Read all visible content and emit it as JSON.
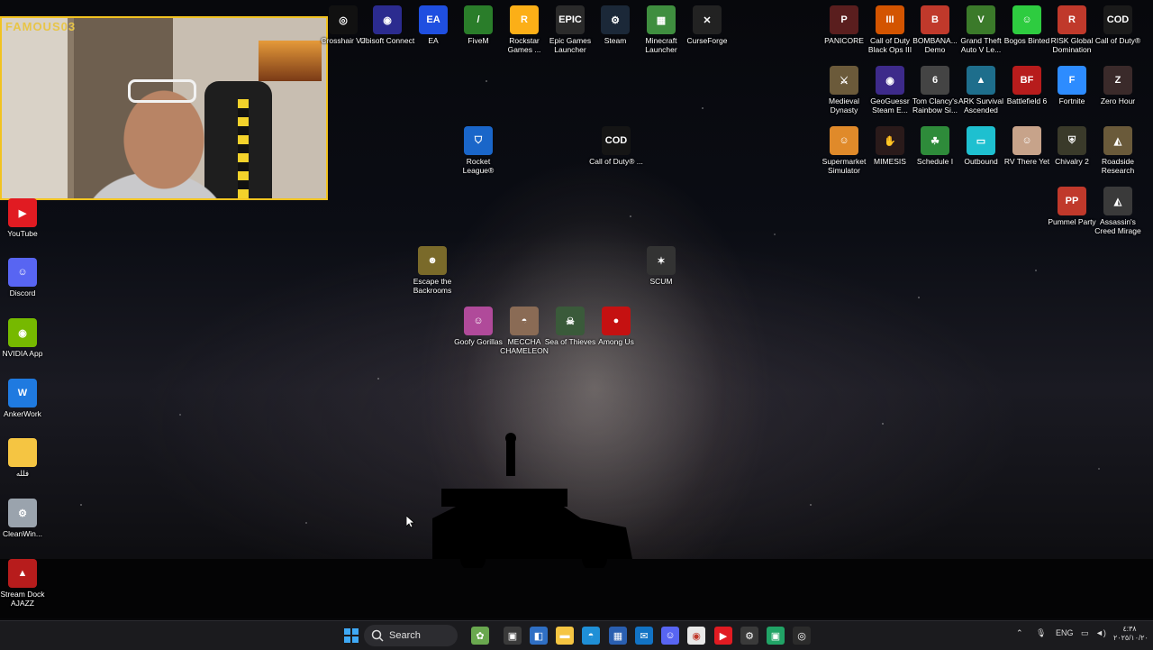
{
  "webcam": {
    "brand": "FAMOUS03"
  },
  "desktop_left": [
    {
      "label": "YouTube",
      "color": "#e11b22",
      "icon": "youtube-icon",
      "glyph": "▶"
    },
    {
      "label": "Discord",
      "color": "#5865f2",
      "icon": "discord-icon",
      "glyph": "☺"
    },
    {
      "label": "NVIDIA App",
      "color": "#76b900",
      "icon": "nvidia-icon",
      "glyph": "◉"
    },
    {
      "label": "AnkerWork",
      "color": "#1f7ae0",
      "icon": "ankerwork-icon",
      "glyph": "W"
    },
    {
      "label": "فلله",
      "color": "#f5c542",
      "icon": "folder-icon",
      "glyph": ""
    },
    {
      "label": "CleanWin...",
      "color": "#9aa3ad",
      "icon": "cleanwin-icon",
      "glyph": "⚙"
    },
    {
      "label": "Stream Dock AJAZZ",
      "color": "#b71c1c",
      "icon": "streamdock-icon",
      "glyph": "▲"
    }
  ],
  "desktop_top": [
    {
      "label": "Crosshair V2",
      "color": "#111111",
      "icon": "crosshair-icon",
      "glyph": "◎"
    },
    {
      "label": "Ubisoft Connect",
      "color": "#2b2b8f",
      "icon": "ubisoft-icon",
      "glyph": "◉"
    },
    {
      "label": "EA",
      "color": "#1f4fe0",
      "icon": "ea-icon",
      "glyph": "EA"
    },
    {
      "label": "FiveM",
      "color": "#2a7d2a",
      "icon": "fivem-icon",
      "glyph": "/"
    },
    {
      "label": "Rockstar Games ...",
      "color": "#fcaf17",
      "icon": "rockstar-icon",
      "glyph": "R"
    },
    {
      "label": "Epic Games Launcher",
      "color": "#2a2a2a",
      "icon": "epic-icon",
      "glyph": "EPIC"
    },
    {
      "label": "Steam",
      "color": "#1b2838",
      "icon": "steam-icon",
      "glyph": "⚙"
    },
    {
      "label": "Minecraft Launcher",
      "color": "#3f8e3f",
      "icon": "minecraft-icon",
      "glyph": "▦"
    },
    {
      "label": "CurseForge",
      "color": "#222222",
      "icon": "curseforge-icon",
      "glyph": "✕"
    }
  ],
  "desktop_mid": [
    {
      "label": "Rocket League®",
      "color": "#1a66c9",
      "icon": "rocket-league-icon",
      "glyph": "⛉"
    },
    {
      "label": "Call of Duty® ...",
      "color": "#151515",
      "icon": "cod-icon",
      "glyph": "COD"
    },
    {
      "label": "Escape the Backrooms",
      "color": "#7a6a2a",
      "icon": "backrooms-icon",
      "glyph": "☻"
    },
    {
      "label": "SCUM",
      "color": "#333333",
      "icon": "scum-icon",
      "glyph": "✶"
    },
    {
      "label": "Goofy Gorillas",
      "color": "#b04a9a",
      "icon": "goofy-gorillas-icon",
      "glyph": "☺"
    },
    {
      "label": "MECCHA CHAMELEON",
      "color": "#8a6b55",
      "icon": "meccha-icon",
      "glyph": "◓"
    },
    {
      "label": "Sea of Thieves",
      "color": "#3a5a3a",
      "icon": "sea-of-thieves-icon",
      "glyph": "☠"
    },
    {
      "label": "Among Us",
      "color": "#c51111",
      "icon": "among-us-icon",
      "glyph": "●"
    }
  ],
  "desktop_right": [
    {
      "label": "PANICORE",
      "color": "#5a1e1e",
      "icon": "panicore-icon",
      "glyph": "P"
    },
    {
      "label": "Call of Duty Black Ops III",
      "color": "#d35400",
      "icon": "bo3-icon",
      "glyph": "III"
    },
    {
      "label": "BOMBANA... Demo",
      "color": "#c0392b",
      "icon": "bombana-icon",
      "glyph": "B"
    },
    {
      "label": "Grand Theft Auto V Le...",
      "color": "#3b7a2a",
      "icon": "gta-icon",
      "glyph": "V"
    },
    {
      "label": "Bogos Binted",
      "color": "#2ecc40",
      "icon": "bogos-icon",
      "glyph": "☺"
    },
    {
      "label": "RISK Global Domination",
      "color": "#c0392b",
      "icon": "risk-icon",
      "glyph": "R"
    },
    {
      "label": "Call of Duty®",
      "color": "#1a1a1a",
      "icon": "cod-hq-icon",
      "glyph": "COD"
    },
    {
      "label": "Medieval Dynasty",
      "color": "#6b5a3a",
      "icon": "medieval-icon",
      "glyph": "⚔"
    },
    {
      "label": "GeoGuessr Steam E...",
      "color": "#3d2a8a",
      "icon": "geoguessr-icon",
      "glyph": "◉"
    },
    {
      "label": "Tom Clancy's Rainbow Si...",
      "color": "#444444",
      "icon": "rainbow-icon",
      "glyph": "6"
    },
    {
      "label": "ARK Survival Ascended",
      "color": "#1e6e8c",
      "icon": "ark-icon",
      "glyph": "▲"
    },
    {
      "label": "Battlefield 6",
      "color": "#b71c1c",
      "icon": "bf6-icon",
      "glyph": "BF"
    },
    {
      "label": "Fortnite",
      "color": "#2d8cff",
      "icon": "fortnite-icon",
      "glyph": "F"
    },
    {
      "label": "Zero Hour",
      "color": "#3a2a2a",
      "icon": "zero-hour-icon",
      "glyph": "Z"
    },
    {
      "label": "Supermarket Simulator",
      "color": "#e08a2a",
      "icon": "supermarket-icon",
      "glyph": "☺"
    },
    {
      "label": "MIMESIS",
      "color": "#2a1a1a",
      "icon": "mimesis-icon",
      "glyph": "✋"
    },
    {
      "label": "Schedule I",
      "color": "#2e8b3a",
      "icon": "schedule-icon",
      "glyph": "☘"
    },
    {
      "label": "Outbound",
      "color": "#1ec0d0",
      "icon": "outbound-icon",
      "glyph": "▭"
    },
    {
      "label": "RV There Yet",
      "color": "#c7a38a",
      "icon": "rv-icon",
      "glyph": "☺"
    },
    {
      "label": "Chivalry 2",
      "color": "#3a3a2a",
      "icon": "chivalry-icon",
      "glyph": "⛨"
    },
    {
      "label": "Roadside Research",
      "color": "#6a5a3a",
      "icon": "roadside-icon",
      "glyph": "◭"
    },
    {
      "label": "Pummel Party",
      "color": "#c0392b",
      "icon": "pummel-icon",
      "glyph": "PP"
    },
    {
      "label": "Assassin's Creed Mirage",
      "color": "#3a3a3a",
      "icon": "ac-mirage-icon",
      "glyph": "◭"
    }
  ],
  "taskbar": {
    "search_label": "Search",
    "tray_lang": "ENG",
    "tray_time": "٤:٣٨",
    "tray_date": "٢٠٢٥/١٠/٢٠",
    "pinned": [
      {
        "name": "frog-app",
        "color": "#6aa84f",
        "glyph": "✿"
      },
      {
        "name": "task-view",
        "color": "#3a3a3a",
        "glyph": "▣"
      },
      {
        "name": "app-vs",
        "color": "#2f6fc4",
        "glyph": "◧"
      },
      {
        "name": "file-explorer",
        "color": "#f5c542",
        "glyph": "▬"
      },
      {
        "name": "edge",
        "color": "#1f8fd6",
        "glyph": "◓"
      },
      {
        "name": "store",
        "color": "#2a5fb0",
        "glyph": "▦"
      },
      {
        "name": "outlook",
        "color": "#1273c4",
        "glyph": "✉"
      },
      {
        "name": "discord",
        "color": "#5865f2",
        "glyph": "☺"
      },
      {
        "name": "chrome",
        "color": "#e8e8e8",
        "glyph": "◉"
      },
      {
        "name": "youtube",
        "color": "#e11b22",
        "glyph": "▶"
      },
      {
        "name": "settings",
        "color": "#3a3a3a",
        "glyph": "⚙"
      },
      {
        "name": "messenger",
        "color": "#21a366",
        "glyph": "▣"
      },
      {
        "name": "obs",
        "color": "#2b2b2b",
        "glyph": "◎"
      }
    ]
  }
}
